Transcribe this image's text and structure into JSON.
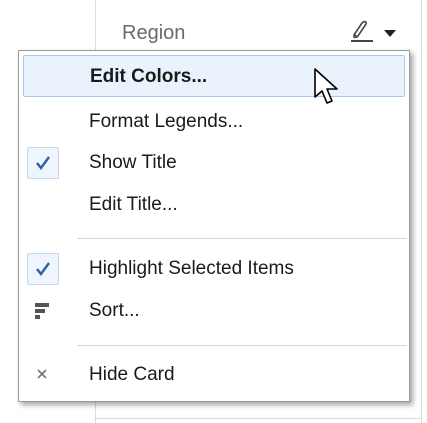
{
  "card": {
    "title": "Region"
  },
  "icons": {
    "edit": "pen-icon",
    "dropdown": "chevron-down-icon",
    "check": "checkmark-icon",
    "sort": "sort-icon",
    "close": "close-icon",
    "cursor": "mouse-pointer-icon"
  },
  "colors": {
    "highlight_bg": "#eaf3fc",
    "highlight_border": "#a9c9ee",
    "check_blue": "#2b5fa8"
  },
  "menu": {
    "items": [
      {
        "label": "Edit Colors...",
        "checked": false,
        "highlighted": true
      },
      {
        "label": "Format Legends...",
        "checked": false
      },
      {
        "label": "Show Title",
        "checked": true
      },
      {
        "label": "Edit Title...",
        "checked": false
      },
      {
        "label": "Highlight Selected Items",
        "checked": true
      },
      {
        "label": "Sort...",
        "checked": false
      },
      {
        "label": "Hide Card",
        "checked": false
      }
    ]
  }
}
